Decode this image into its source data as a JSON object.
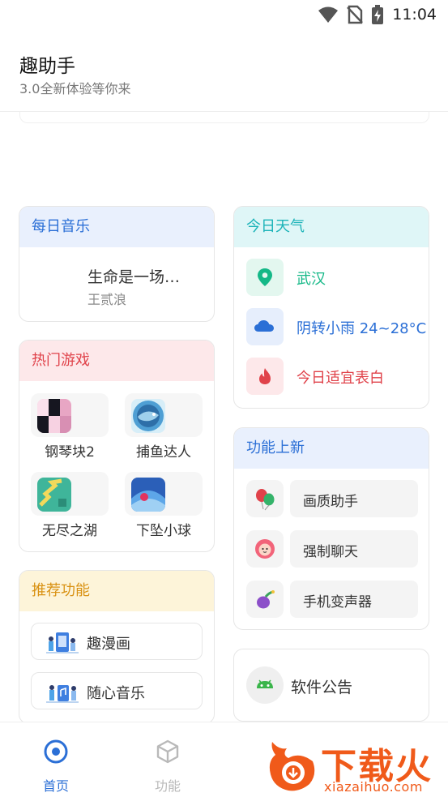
{
  "status": {
    "time": "11:04"
  },
  "header": {
    "title": "趣助手",
    "subtitle": "3.0全新体验等你来"
  },
  "music": {
    "title": "每日音乐",
    "song": "生命是一场…",
    "artist": "王贰浪"
  },
  "games": {
    "title": "热门游戏",
    "items": [
      {
        "label": "钢琴块2"
      },
      {
        "label": "捕鱼达人"
      },
      {
        "label": "无尽之湖"
      },
      {
        "label": "下坠小球"
      }
    ]
  },
  "recommend": {
    "title": "推荐功能",
    "items": [
      {
        "label": "趣漫画"
      },
      {
        "label": "随心音乐"
      }
    ]
  },
  "weather": {
    "title": "今日天气",
    "city": "武汉",
    "condition": "阴转小雨 24~28°C",
    "tip": "今日适宜表白"
  },
  "features": {
    "title": "功能上新",
    "items": [
      {
        "label": "画质助手"
      },
      {
        "label": "强制聊天"
      },
      {
        "label": "手机变声器"
      }
    ]
  },
  "notice": {
    "label": "软件公告"
  },
  "nav": {
    "home": "首页",
    "functions": "功能"
  },
  "watermark": {
    "text": "下载火",
    "sub": "xiazaihuo.com"
  },
  "colors": {
    "blue_accent": "#2b6fd6",
    "teal_accent": "#1bb3b8",
    "red_accent": "#e0424a",
    "yellow_accent": "#d99214",
    "nav_active": "#2b6fd6",
    "nav_inactive": "#b9b9b9"
  }
}
